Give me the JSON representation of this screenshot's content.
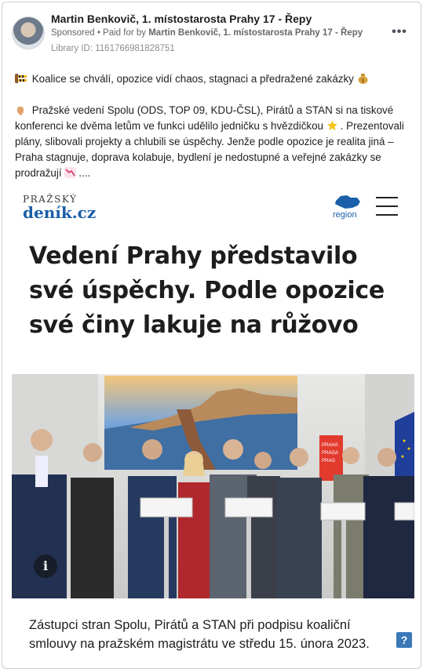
{
  "post": {
    "page_name": "Martin Benkovič, 1. místostarosta Prahy 17 - Řepy",
    "sponsored": "Sponsored",
    "separator": " • ",
    "paid_for_prefix": "Paid for by ",
    "paid_for_name": "Martin Benkovič, 1. místostarosta Prahy 17 - Řepy",
    "library_id": "Library ID: 1161766981828751",
    "more_icon": "more-horizontal-icon",
    "more_label": "•••",
    "paragraph_1": "Koalice se chválí, opozice vidí chaos, stagnaci a předražené zakázky",
    "paragraph_2": "Pražské vedení Spolu (ODS, TOP 09, KDU-ČSL), Pirátů a STAN si na tiskové konferenci ke dvěma letům ve funkci udělilo jedničku s hvězdičkou",
    "paragraph_2b": ". Prezentovali plány, slibovali projekty a chlubili se úspěchy. Jenže podle opozice je realita jiná – Praha stagnuje, doprava kolabuje, bydlení je nedostupné a veřejné zakázky se prodražují",
    "paragraph_2_end": "....",
    "emoji_icons": [
      "construction-icon",
      "money-bag-icon",
      "pointing-hand-icon",
      "star-icon",
      "chart-decreasing-icon"
    ]
  },
  "article": {
    "brand_top": "PRAŽSKÝ",
    "brand_bottom": "deník.cz",
    "region_label": "region",
    "headline": "Vedení Prahy představilo své úspěchy. Podle opozice své činy lakuje na růžovo",
    "caption": "Zástupci stran Spolu, Pirátů a STAN při podpisu koaliční smlouvy na pražském magistrátu ve středu 15. února 2023.",
    "info_label": "i",
    "help_label": "?",
    "sign_text": "PRAHA PRAGA PRAG"
  },
  "colors": {
    "brand_blue": "#1a5fa8",
    "meta_gray": "#65676b",
    "help_blue": "#3b78b8"
  }
}
